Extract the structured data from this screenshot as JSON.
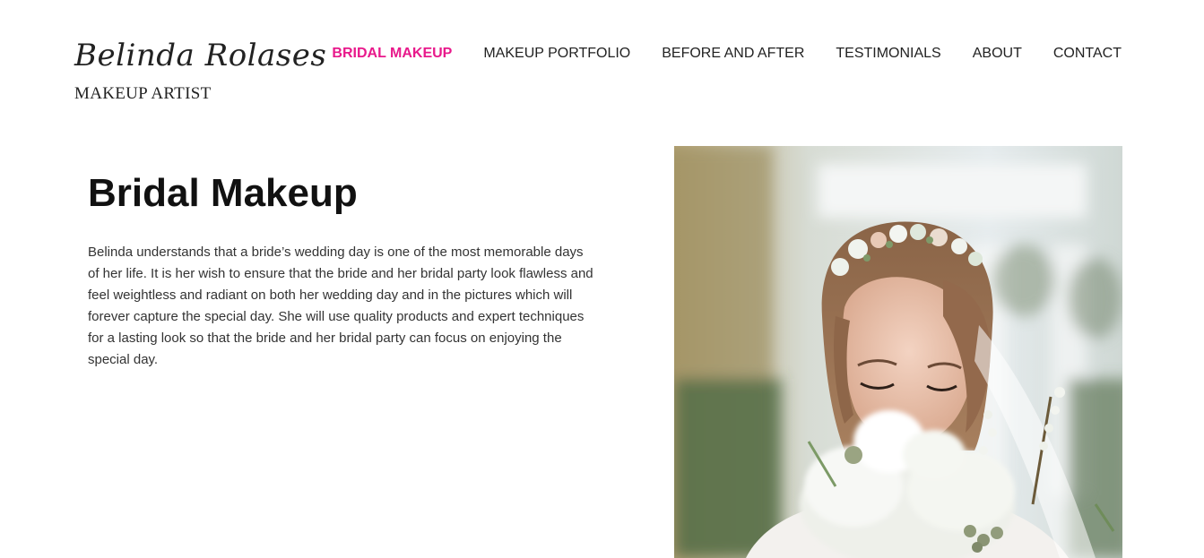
{
  "brand": {
    "name": "Belinda Rolases",
    "subtitle": "MAKEUP ARTIST"
  },
  "nav": {
    "items": [
      {
        "label": "BRIDAL MAKEUP",
        "active": true
      },
      {
        "label": "MAKEUP PORTFOLIO",
        "active": false
      },
      {
        "label": "BEFORE AND AFTER",
        "active": false
      },
      {
        "label": "TESTIMONIALS",
        "active": false
      },
      {
        "label": "ABOUT",
        "active": false
      },
      {
        "label": "CONTACT",
        "active": false
      }
    ],
    "active_color": "#e8198b"
  },
  "main": {
    "title": "Bridal Makeup",
    "body": "Belinda understands that a bride’s wedding day is one of the most memorable days of her life. It is her wish to ensure that the bride and her bridal party look flawless and feel weightless and radiant on both her wedding day and in the pictures which will forever capture the special day. She will use quality products and expert techniques for a lasting look so that the bride and her bridal party can focus on enjoying the special day."
  }
}
